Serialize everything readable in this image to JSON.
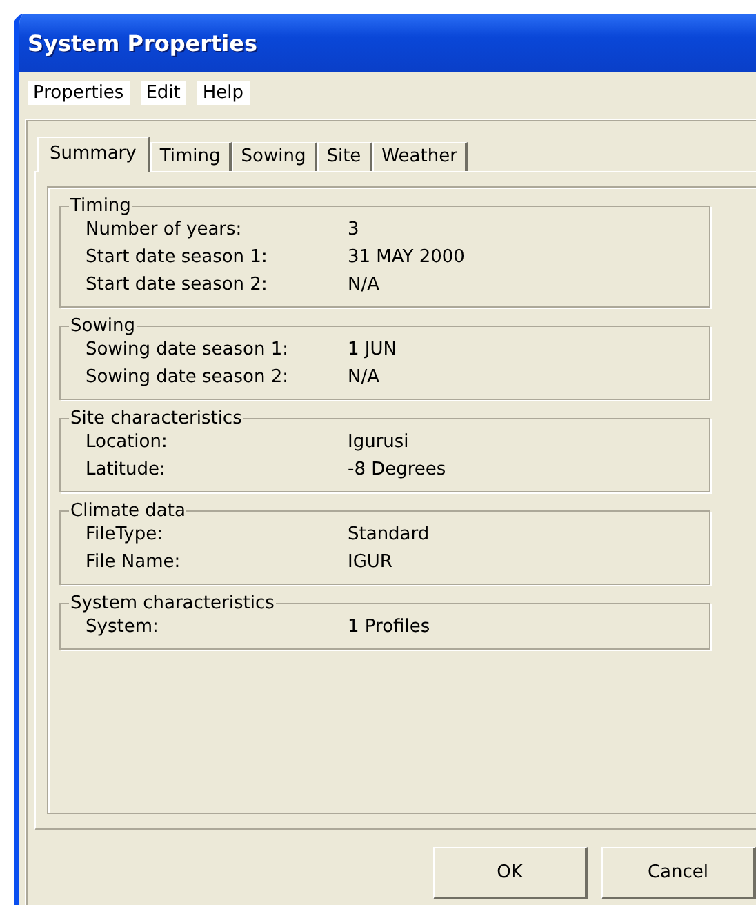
{
  "window": {
    "title": "System Properties"
  },
  "menu": [
    "Properties",
    "Edit",
    "Help"
  ],
  "tabs": [
    {
      "label": "Summary",
      "selected": true
    },
    {
      "label": "Timing",
      "selected": false
    },
    {
      "label": "Sowing",
      "selected": false
    },
    {
      "label": "Site",
      "selected": false
    },
    {
      "label": "Weather",
      "selected": false
    }
  ],
  "groups": [
    {
      "title": "Timing",
      "rows": [
        {
          "label": "Number of years:",
          "value": "3"
        },
        {
          "label": "Start date season 1:",
          "value": "31 MAY 2000"
        },
        {
          "label": "Start date season 2:",
          "value": "N/A"
        }
      ]
    },
    {
      "title": "Sowing",
      "rows": [
        {
          "label": "Sowing date season 1:",
          "value": "1 JUN"
        },
        {
          "label": "Sowing date season 2:",
          "value": "N/A"
        }
      ]
    },
    {
      "title": "Site characteristics",
      "rows": [
        {
          "label": "Location:",
          "value": "Igurusi"
        },
        {
          "label": "Latitude:",
          "value": "-8 Degrees"
        }
      ]
    },
    {
      "title": "Climate data",
      "rows": [
        {
          "label": "FileType:",
          "value": "Standard"
        },
        {
          "label": "File Name:",
          "value": "IGUR"
        }
      ]
    },
    {
      "title": "System characteristics",
      "rows": [
        {
          "label": "System:",
          "value": "1 Profiles"
        }
      ]
    }
  ],
  "buttons": [
    "OK",
    "Cancel"
  ]
}
